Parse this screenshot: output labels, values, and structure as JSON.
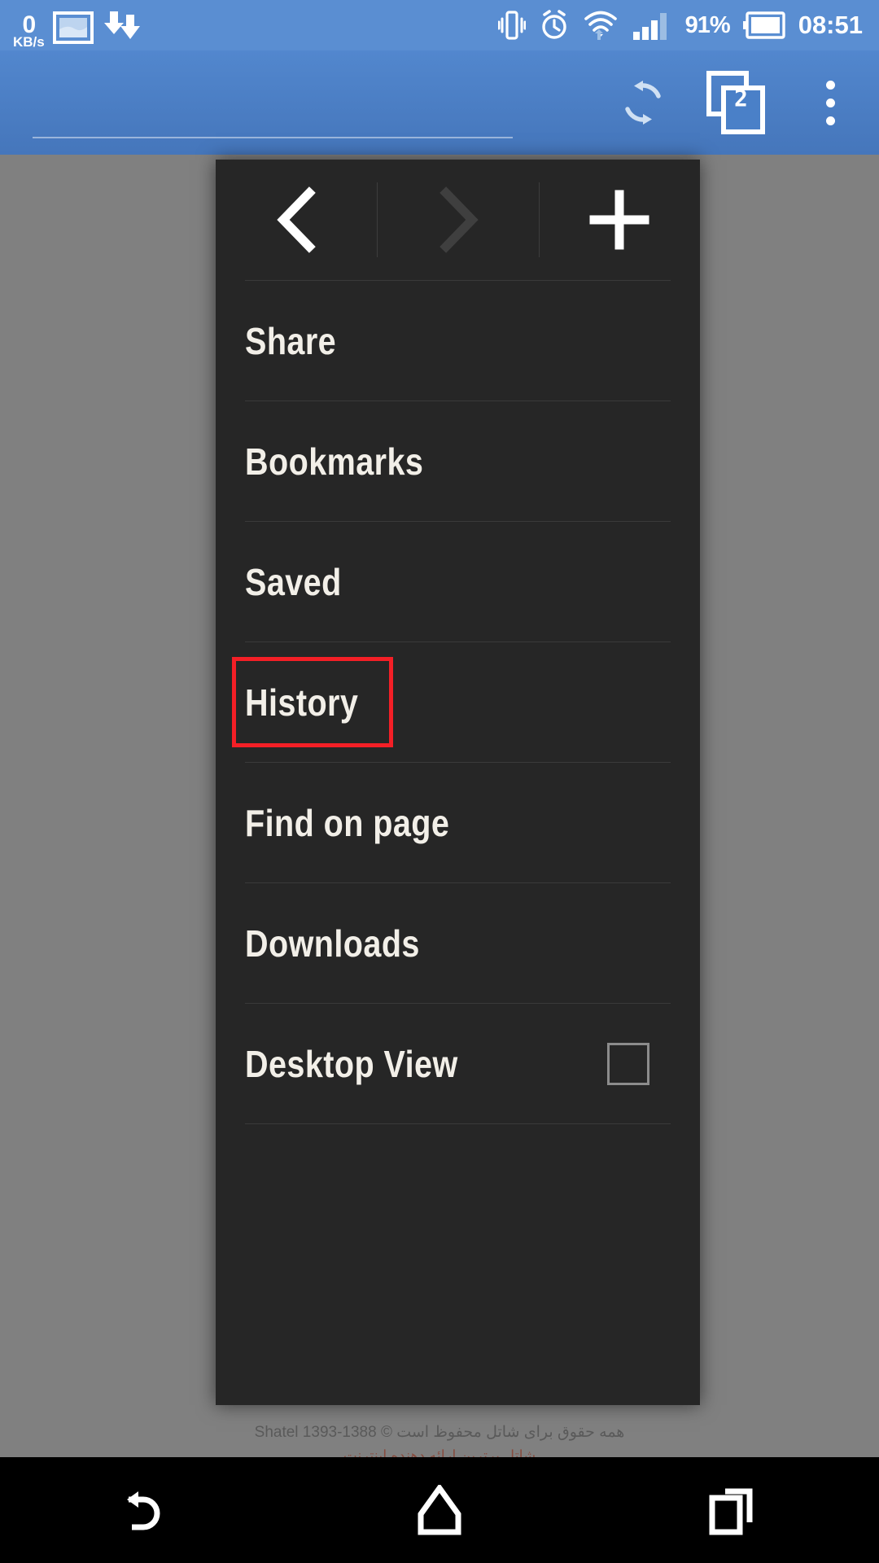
{
  "statusbar": {
    "network_speed_value": "0",
    "network_speed_unit": "KB/s",
    "battery_percent": "91%",
    "clock": "08:51",
    "icons": [
      "screenshot-icon",
      "download-icon",
      "vibrate-icon",
      "alarm-icon",
      "wifi-icon",
      "signal-icon",
      "battery-icon"
    ]
  },
  "browser": {
    "reload_label": "",
    "tab_count": "2",
    "overflow_label": ""
  },
  "menu": {
    "nav": {
      "back": "‹",
      "forward": "›",
      "new_tab": "+"
    },
    "items": [
      {
        "label": "Share",
        "checkbox": false,
        "highlighted": false
      },
      {
        "label": "Bookmarks",
        "checkbox": false,
        "highlighted": false
      },
      {
        "label": "Saved",
        "checkbox": false,
        "highlighted": false
      },
      {
        "label": "History",
        "checkbox": false,
        "highlighted": true
      },
      {
        "label": "Find on page",
        "checkbox": false,
        "highlighted": false
      },
      {
        "label": "Downloads",
        "checkbox": false,
        "highlighted": false
      },
      {
        "label": "Desktop View",
        "checkbox": true,
        "highlighted": false
      }
    ]
  },
  "page": {
    "footer_line1": "همه حقوق برای شاتل محفوظ است © Shatel 1393-1388",
    "footer_line2": "شاتل برترین ارائه دهنده اینترنت"
  },
  "navbar": {
    "back": "back-icon",
    "home": "home-icon",
    "recents": "recents-icon"
  },
  "colors": {
    "status_blue": "#5a8ed2",
    "chrome_blue": "#4a80c8",
    "menu_bg": "#262626",
    "menu_text": "#f2efe8",
    "highlight_red": "#f41f26",
    "scrim_gray": "#808080"
  }
}
